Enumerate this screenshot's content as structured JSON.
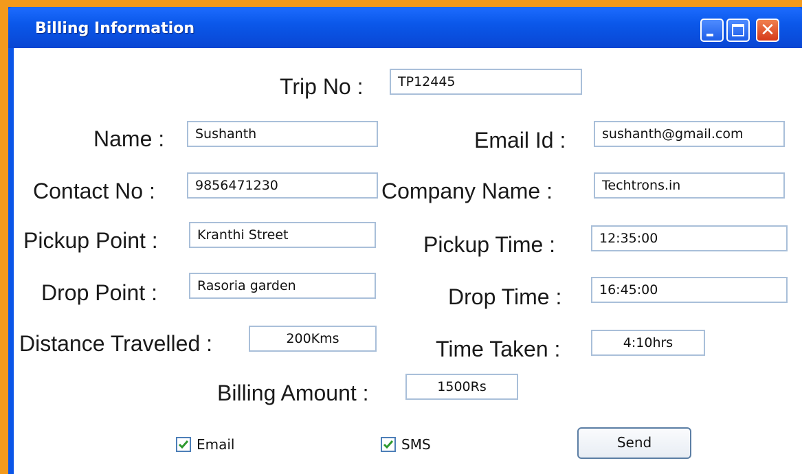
{
  "window": {
    "title": "Billing Information"
  },
  "form": {
    "trip_no": {
      "label": "Trip No :",
      "value": "TP12445"
    },
    "name": {
      "label": "Name :",
      "value": "Sushanth"
    },
    "email_id": {
      "label": "Email Id :",
      "value": "sushanth@gmail.com"
    },
    "contact_no": {
      "label": "Contact No :",
      "value": "9856471230"
    },
    "company_name": {
      "label": "Company Name :",
      "value": "Techtrons.in"
    },
    "pickup_point": {
      "label": "Pickup Point :",
      "value": "Kranthi Street"
    },
    "pickup_time": {
      "label": "Pickup Time :",
      "value": "12:35:00"
    },
    "drop_point": {
      "label": "Drop Point :",
      "value": "Rasoria garden"
    },
    "drop_time": {
      "label": "Drop Time :",
      "value": "16:45:00"
    },
    "distance_travelled": {
      "label": "Distance Travelled :",
      "value": "200Kms"
    },
    "time_taken": {
      "label": "Time Taken :",
      "value": "4:10hrs"
    },
    "billing_amount": {
      "label": "Billing Amount :",
      "value": "1500Rs"
    }
  },
  "options": {
    "email": {
      "label": "Email",
      "checked": true
    },
    "sms": {
      "label": "SMS",
      "checked": true
    }
  },
  "actions": {
    "send_label": "Send"
  },
  "colors": {
    "window_blue": "#0a55e8",
    "background_orange": "#f39a1c",
    "close_red": "#d5391a",
    "check_green": "#2f9a2f"
  },
  "icons": {
    "minimize": "minimize-icon",
    "maximize": "maximize-icon",
    "close": "close-icon",
    "check": "checkmark-icon"
  }
}
